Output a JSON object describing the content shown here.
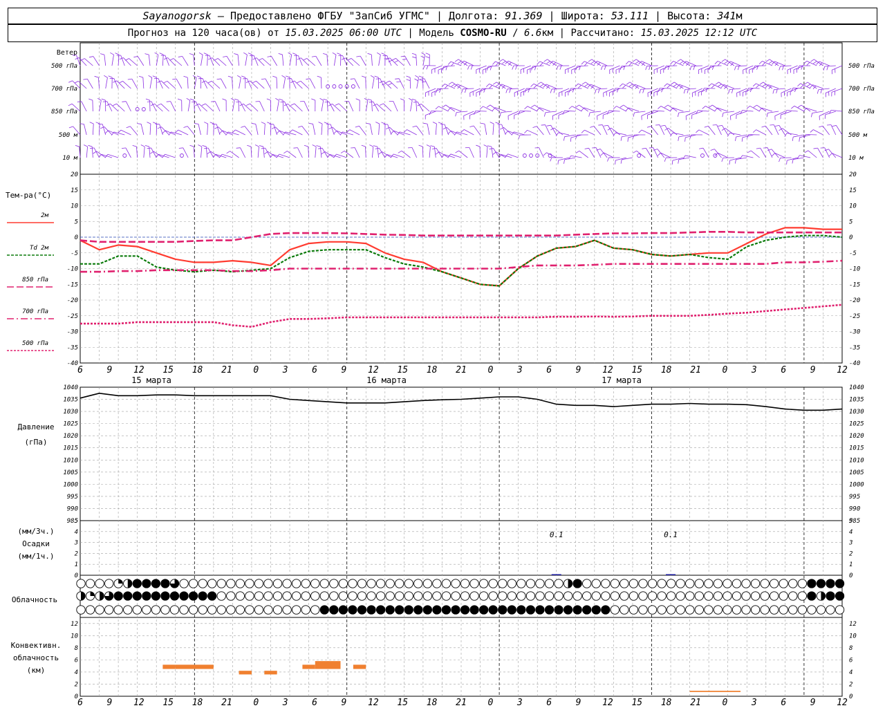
{
  "header": {
    "station": "Sayanogorsk",
    "dash": " — ",
    "provider": "Предоставлено ФГБУ \"ЗапСиб УГМС\"",
    "lon_label": "Долгота:",
    "lon": "91.369",
    "lat_label": "Широта:",
    "lat": "53.111",
    "alt_label": "Высота:",
    "alt": "341",
    "alt_unit": "м",
    "forecast_prefix": "Прогноз на 120 часа(ов) от",
    "forecast_start": "15.03.2025 06:00 UTC",
    "model_label": "Модель",
    "model": "COSMO-RU",
    "model_res": "6.6",
    "model_res_unit": "км",
    "computed_label": "Рассчитано:",
    "computed": "15.03.2025 12:12 UTC",
    "sep": " | "
  },
  "colors": {
    "wind": "#8a2be2",
    "t2m": "#ff3b30",
    "td2m": "#0a7a0a",
    "t850": "#e0206e",
    "t700": "#e0206e",
    "t500": "#e0206e",
    "pressure": "#000000",
    "precip": "#2020a0",
    "convective": "#f08030",
    "grid": "#a0a0a0"
  },
  "chart_data": [
    {
      "type": "wind_barbs",
      "panel_label": "Ветер",
      "levels": [
        "500 гПа",
        "700 гПа",
        "850 гПа",
        "500 м",
        "10  м"
      ],
      "calm_hours": {
        "850 гПа": [
          9,
          10
        ],
        "700 гПа": [
          39,
          40,
          41,
          42,
          43
        ],
        "10  м": [
          7,
          16,
          70,
          71,
          72,
          74,
          88,
          98,
          100
        ]
      }
    },
    {
      "type": "line",
      "panel_label": "Тем-ра(°C)",
      "ylim": [
        -40,
        20
      ],
      "yticks": [
        20,
        15,
        10,
        5,
        0,
        -5,
        -10,
        -15,
        -20,
        -25,
        -30,
        -35,
        -40
      ],
      "x_hours_from_start": [
        0,
        3,
        6,
        9,
        12,
        15,
        18,
        21,
        24,
        27,
        30,
        33,
        36,
        39,
        42,
        45,
        48,
        51,
        54,
        57,
        60,
        63,
        66,
        69,
        72,
        75,
        78,
        81,
        84,
        87,
        90,
        93,
        96,
        99,
        102,
        105,
        108,
        111,
        114,
        117,
        120
      ],
      "series": [
        {
          "name": "2м",
          "style": "solid",
          "values": [
            -1,
            -4,
            -2.5,
            -3,
            -5,
            -7,
            -8,
            -8,
            -7.5,
            -8,
            -9,
            -4,
            -2,
            -1.5,
            -1.5,
            -2,
            -5,
            -7,
            -8,
            -11,
            -13,
            -15,
            -15.5,
            -10,
            -6,
            -3.5,
            -3,
            -1,
            -3.5,
            -4,
            -5.5,
            -6,
            -5.5,
            -5,
            -5,
            -2,
            1,
            3,
            3,
            2.5,
            2.5
          ]
        },
        {
          "name": "Td 2м",
          "style": "dashed",
          "values": [
            -8.5,
            -8.5,
            -6,
            -6,
            -9.5,
            -10.5,
            -11,
            -10.5,
            -11,
            -10.5,
            -10,
            -6.5,
            -4.5,
            -4,
            -4,
            -4,
            -6.5,
            -8.5,
            -9.5,
            -11,
            -13,
            -15,
            -15.5,
            -10,
            -6,
            -3.5,
            -3,
            -1,
            -3.5,
            -4,
            -5.5,
            -6,
            -5.5,
            -6.5,
            -7,
            -3,
            -1,
            0,
            0.5,
            0.5,
            0
          ]
        },
        {
          "name": "850 гПа",
          "style": "long-dash",
          "values": [
            -1,
            -1.5,
            -1.5,
            -1.5,
            -1.5,
            -1.5,
            -1.2,
            -1,
            -1,
            0,
            1,
            1.3,
            1.3,
            1.3,
            1.2,
            1,
            0.8,
            0.7,
            0.5,
            0.5,
            0.5,
            0.5,
            0.5,
            0.5,
            0.5,
            0.5,
            0.8,
            1,
            1.2,
            1.2,
            1.3,
            1.3,
            1.5,
            1.7,
            1.7,
            1.5,
            1.5,
            1.5,
            1.5,
            1.5,
            1.5
          ]
        },
        {
          "name": "700 гПа",
          "style": "dash-dot",
          "values": [
            -11,
            -11,
            -10.8,
            -10.8,
            -10.5,
            -10.5,
            -10.5,
            -10.5,
            -10.8,
            -10.8,
            -10.5,
            -10,
            -10,
            -10,
            -10,
            -10,
            -10,
            -10,
            -10,
            -10,
            -10,
            -10,
            -10,
            -9.5,
            -9,
            -9,
            -9,
            -8.8,
            -8.5,
            -8.5,
            -8.5,
            -8.5,
            -8.5,
            -8.5,
            -8.5,
            -8.5,
            -8.5,
            -8,
            -8,
            -7.8,
            -7.5
          ]
        },
        {
          "name": "500 гПа",
          "style": "dotted",
          "values": [
            -27.5,
            -27.5,
            -27.5,
            -27,
            -27,
            -27,
            -27,
            -27,
            -28,
            -28.5,
            -27,
            -26,
            -26,
            -25.8,
            -25.5,
            -25.5,
            -25.5,
            -25.5,
            -25.5,
            -25.5,
            -25.5,
            -25.5,
            -25.5,
            -25.5,
            -25.5,
            -25.3,
            -25.3,
            -25.2,
            -25.3,
            -25.2,
            -25,
            -25,
            -25,
            -24.7,
            -24.3,
            -24,
            -23.5,
            -23,
            -22.5,
            -22,
            -21.5
          ]
        }
      ]
    },
    {
      "type": "line",
      "panel_label": "Давление",
      "panel_unit": "(гПа)",
      "ylim": [
        985,
        1040
      ],
      "yticks": [
        1040,
        1035,
        1030,
        1025,
        1020,
        1015,
        1010,
        1005,
        1000,
        995,
        990,
        985
      ],
      "series": [
        {
          "name": "Давление",
          "values": [
            1035.5,
            1037.5,
            1036.5,
            1036.5,
            1036.8,
            1036.8,
            1036.5,
            1036.5,
            1036.5,
            1036.5,
            1036.5,
            1035,
            1034.5,
            1034,
            1033.5,
            1033.5,
            1033.5,
            1034,
            1034.5,
            1034.8,
            1035,
            1035.5,
            1036,
            1036,
            1035,
            1033,
            1032.5,
            1032.5,
            1032,
            1032.5,
            1033,
            1033,
            1033.3,
            1033,
            1033,
            1032.8,
            1032,
            1031,
            1030.5,
            1030.5,
            1031
          ]
        }
      ]
    },
    {
      "type": "bar",
      "panel_label": "Осадки",
      "panel_unit_top": "(мм/3ч.)",
      "panel_unit_bottom": "(мм/1ч.)",
      "ylim": [
        0,
        5
      ],
      "yticks": [
        5,
        4,
        3,
        2,
        1,
        0
      ],
      "events": [
        {
          "hour": 75,
          "value": 0.1,
          "label": "0.1"
        },
        {
          "hour": 93,
          "value": 0.1,
          "label": "0.1"
        }
      ]
    },
    {
      "type": "table",
      "panel_label": "Облачность",
      "cover_codes": "0=clear 1=quarter 2=half 3=three-quarters 4=overcast",
      "rows": [
        {
          "name": "upper",
          "values": "000000001224444444330000000000000000000000000000000000000000000000000000000000000000000000000000002400000000000000000000000000000000000000000000004444444"
        },
        {
          "name": "middle",
          "values": "231224344444444444444444444440000000000000000000000000000000000000000000000000000000000000000000000000000000000000000000000000000000000000000000000004324444"
        },
        {
          "name": "low",
          "values": "0000000000000000000000000000000000000000000000000444444444444444444444444444444444444444444444444444444444444000000000000000000000000000000000000000000000000"
        }
      ]
    },
    {
      "type": "bar",
      "panel_label": "Конвективн. облачность (км)",
      "panel_label_lines": [
        "Конвективн.",
        "облачность",
        "(км)"
      ],
      "ylim": [
        0,
        13
      ],
      "yticks": [
        12,
        10,
        8,
        6,
        4,
        2,
        0
      ],
      "segments": [
        {
          "start_hour": 13,
          "end_hour": 15,
          "bottom": 4.5,
          "top": 5.2
        },
        {
          "start_hour": 15,
          "end_hour": 21,
          "bottom": 4.5,
          "top": 5.2
        },
        {
          "start_hour": 25,
          "end_hour": 27,
          "bottom": 3.6,
          "top": 4.2
        },
        {
          "start_hour": 29,
          "end_hour": 31,
          "bottom": 3.6,
          "top": 4.2
        },
        {
          "start_hour": 35,
          "end_hour": 37,
          "bottom": 4.5,
          "top": 5.2
        },
        {
          "start_hour": 37,
          "end_hour": 41,
          "bottom": 4.5,
          "top": 5.8
        },
        {
          "start_hour": 43,
          "end_hour": 45,
          "bottom": 4.5,
          "top": 5.2
        },
        {
          "start_hour": 96,
          "end_hour": 104,
          "bottom": 0.7,
          "top": 0.9
        }
      ]
    }
  ],
  "axis": {
    "hour_labels": [
      "6",
      "9",
      "12",
      "15",
      "18",
      "21",
      "0",
      "3",
      "6",
      "9",
      "12",
      "15",
      "18",
      "21",
      "0",
      "3",
      "6",
      "9",
      "12",
      "15",
      "18",
      "21",
      "0",
      "3",
      "6",
      "9",
      "12"
    ],
    "days": [
      "15 марта",
      "16 марта",
      "17 марта"
    ]
  }
}
